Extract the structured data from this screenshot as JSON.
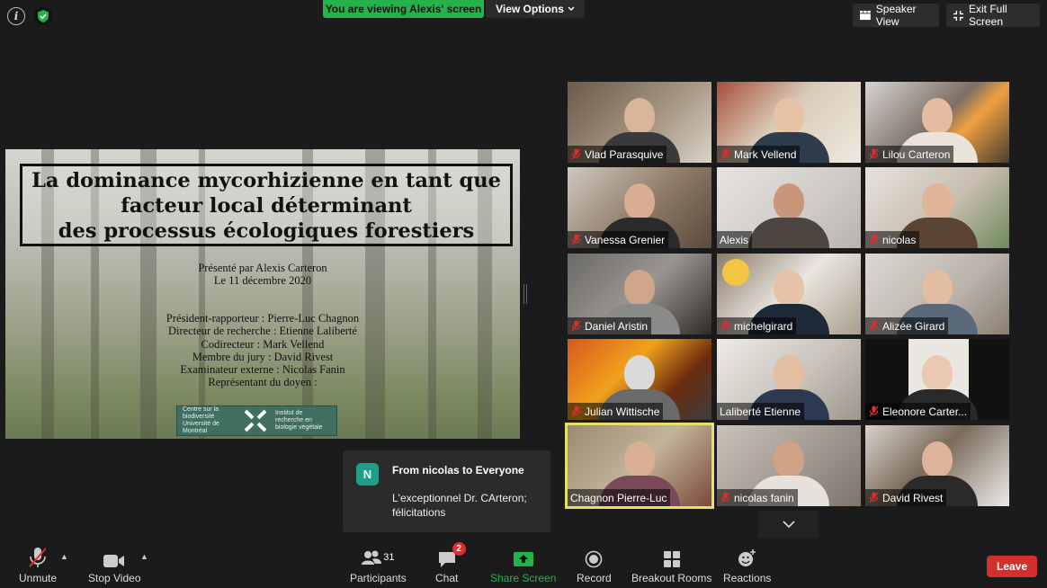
{
  "top": {
    "viewing_banner": "You are viewing Alexis' screen",
    "view_options": "View Options",
    "speaker_view": "Speaker View",
    "exit_full_screen": "Exit Full Screen"
  },
  "slide": {
    "title_lines": [
      "La dominance mycorhizienne en tant que",
      "facteur local déterminant",
      "des processus écologiques forestiers"
    ],
    "presenter": "Présenté par Alexis Carteron",
    "date": "Le 11 décembre 2020",
    "committee": [
      "Président-rapporteur : Pierre-Luc Chagnon",
      "Directeur de recherche : Etienne Laliberté",
      "Codirecteur : Mark Vellend",
      "Membre du jury : David Rivest",
      "Examinateur externe : Nicolas Fanin",
      "Représentant du doyen :"
    ],
    "logo_left": "Centre sur la biodiversité Université de Montréal",
    "logo_right": "Institut de recherche en biologie végétale"
  },
  "participants": [
    {
      "name": "Vlad Parasquive",
      "muted": true
    },
    {
      "name": "Mark Vellend",
      "muted": true
    },
    {
      "name": "Lilou Carteron",
      "muted": true
    },
    {
      "name": "Vanessa Grenier",
      "muted": true
    },
    {
      "name": "Alexis",
      "muted": false
    },
    {
      "name": "nicolas",
      "muted": true
    },
    {
      "name": "Daniel Aristin",
      "muted": true
    },
    {
      "name": "michelgirard",
      "muted": true
    },
    {
      "name": "Alizée Girard",
      "muted": true
    },
    {
      "name": "Julian Wittische",
      "muted": true
    },
    {
      "name": "Laliberté Etienne",
      "muted": false
    },
    {
      "name": "Eleonore Carter...",
      "muted": true
    },
    {
      "name": "Chagnon Pierre-Luc",
      "muted": false
    },
    {
      "name": "nicolas fanin",
      "muted": true
    },
    {
      "name": "David Rivest",
      "muted": true
    }
  ],
  "chat": {
    "avatar_letter": "N",
    "from": "From nicolas to Everyone",
    "message": "L'exceptionnel Dr. CArteron; félicitations"
  },
  "toolbar": {
    "unmute": "Unmute",
    "stop_video": "Stop Video",
    "participants": "Participants",
    "participants_count": "31",
    "chat": "Chat",
    "chat_badge": "2",
    "share_screen": "Share Screen",
    "record": "Record",
    "breakout_rooms": "Breakout Rooms",
    "reactions": "Reactions",
    "leave": "Leave"
  },
  "colors": {
    "accent_green": "#26b24a",
    "leave_red": "#d1312d",
    "active_speaker": "#e4e16a"
  }
}
